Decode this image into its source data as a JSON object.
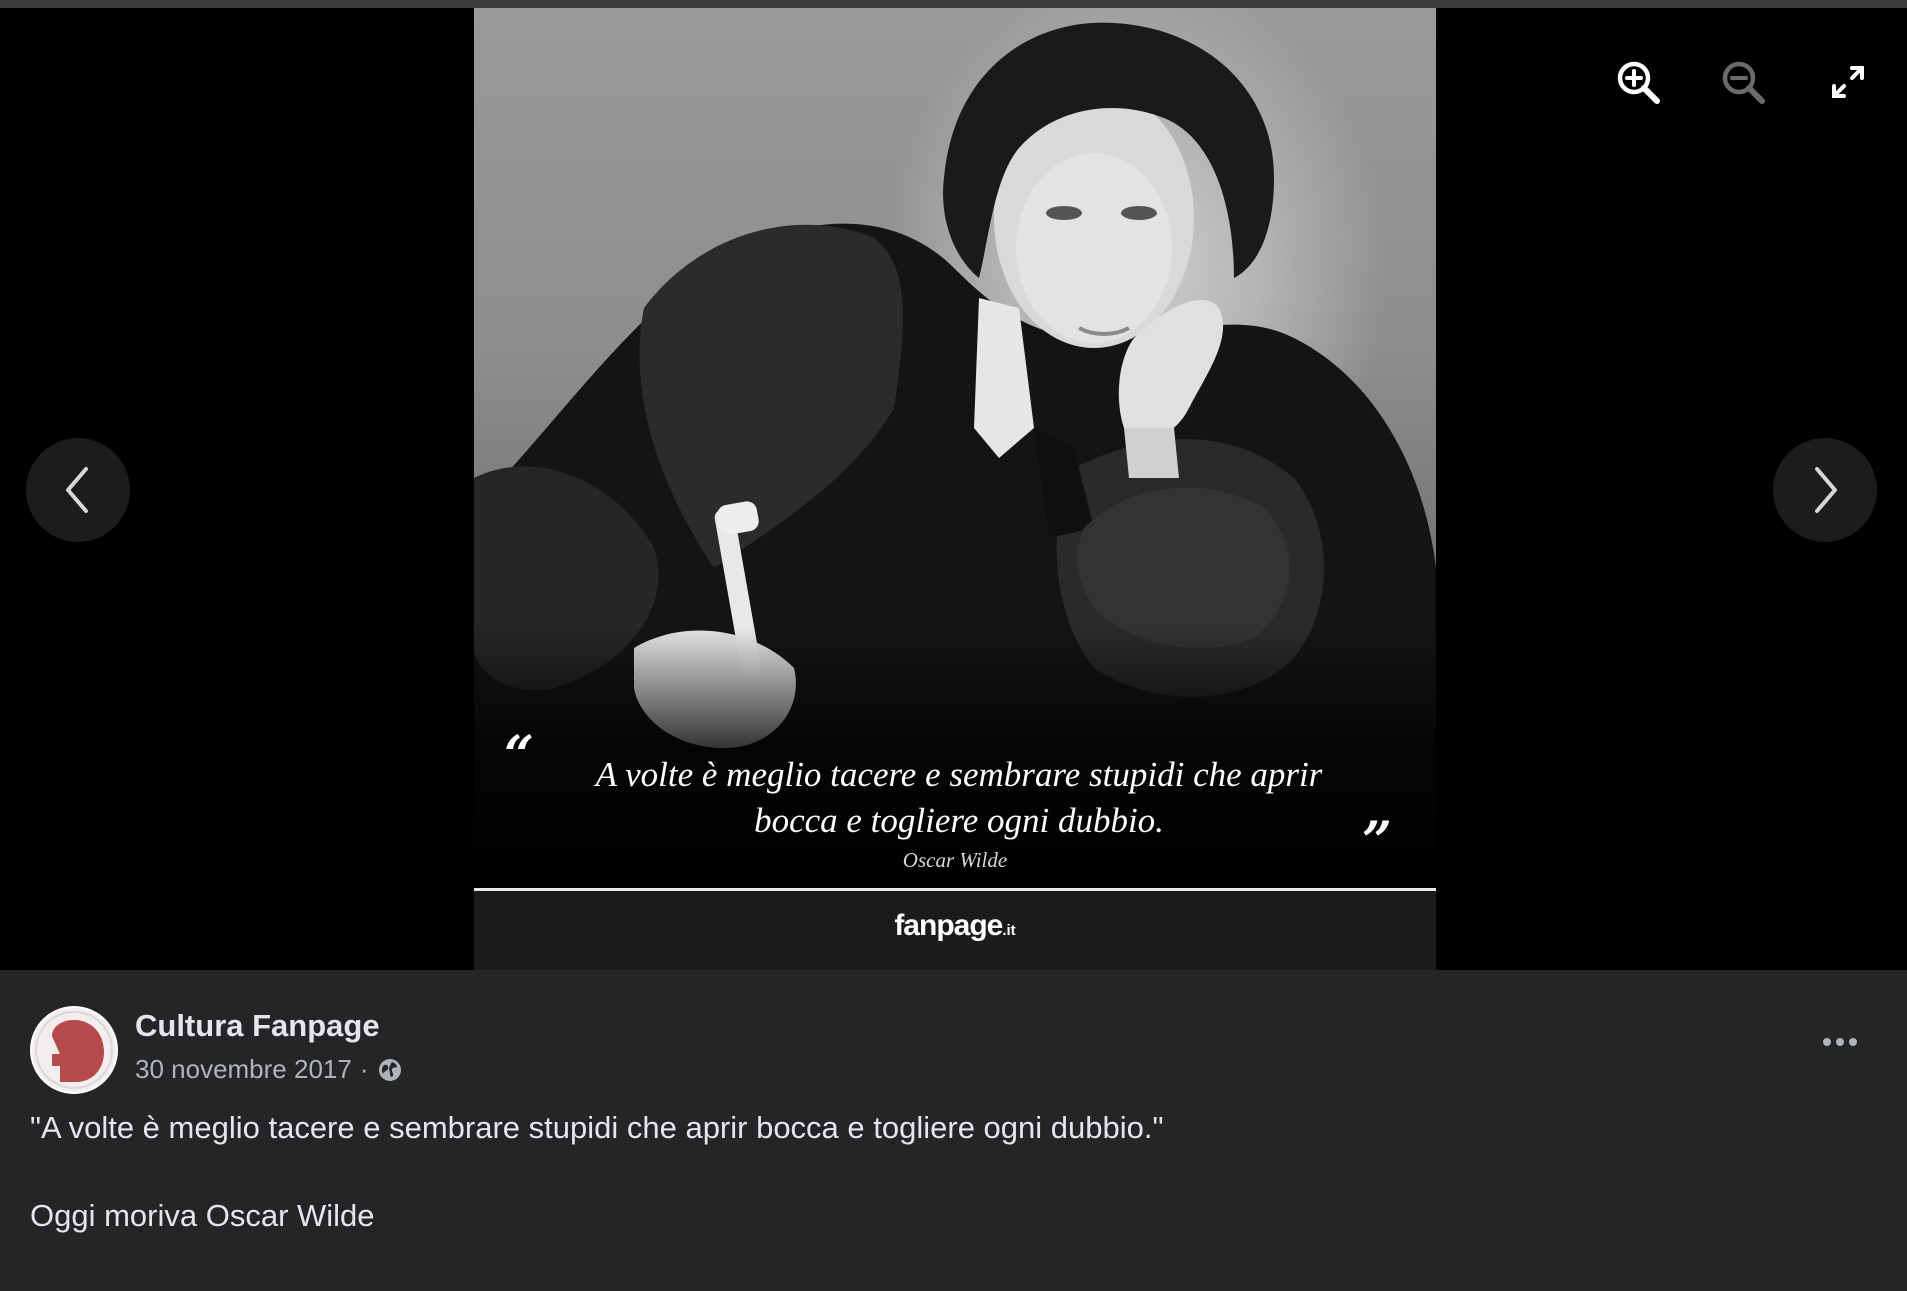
{
  "photo": {
    "quote_open_mark": "“",
    "quote_line_1": "A volte è meglio tacere e sembrare stupidi che aprir",
    "quote_line_2": "bocca e togliere ogni dubbio.",
    "quote_close_mark": "”",
    "quote_author": "Oscar Wilde",
    "brand_main": "fanpage",
    "brand_tld": ".it"
  },
  "controls": {
    "zoom_in_icon": "zoom-in-icon",
    "zoom_out_icon": "zoom-out-icon",
    "fullscreen_icon": "fullscreen-icon",
    "prev_icon": "chevron-left-icon",
    "next_icon": "chevron-right-icon"
  },
  "post": {
    "page_name": "Cultura Fanpage",
    "date": "30 novembre 2017",
    "separator": "·",
    "privacy_icon": "globe-icon",
    "text_line_1": "\"A volte è meglio tacere e sembrare stupidi che aprir bocca e togliere ogni dubbio.\"",
    "text_line_2": "Oggi moriva Oscar Wilde",
    "avatar_color": "#b44a4a"
  },
  "colors": {
    "viewer_bg": "#000000",
    "panel_bg": "#242526",
    "primary_text": "#e4e6eb",
    "secondary_text": "#b0b3b8"
  }
}
